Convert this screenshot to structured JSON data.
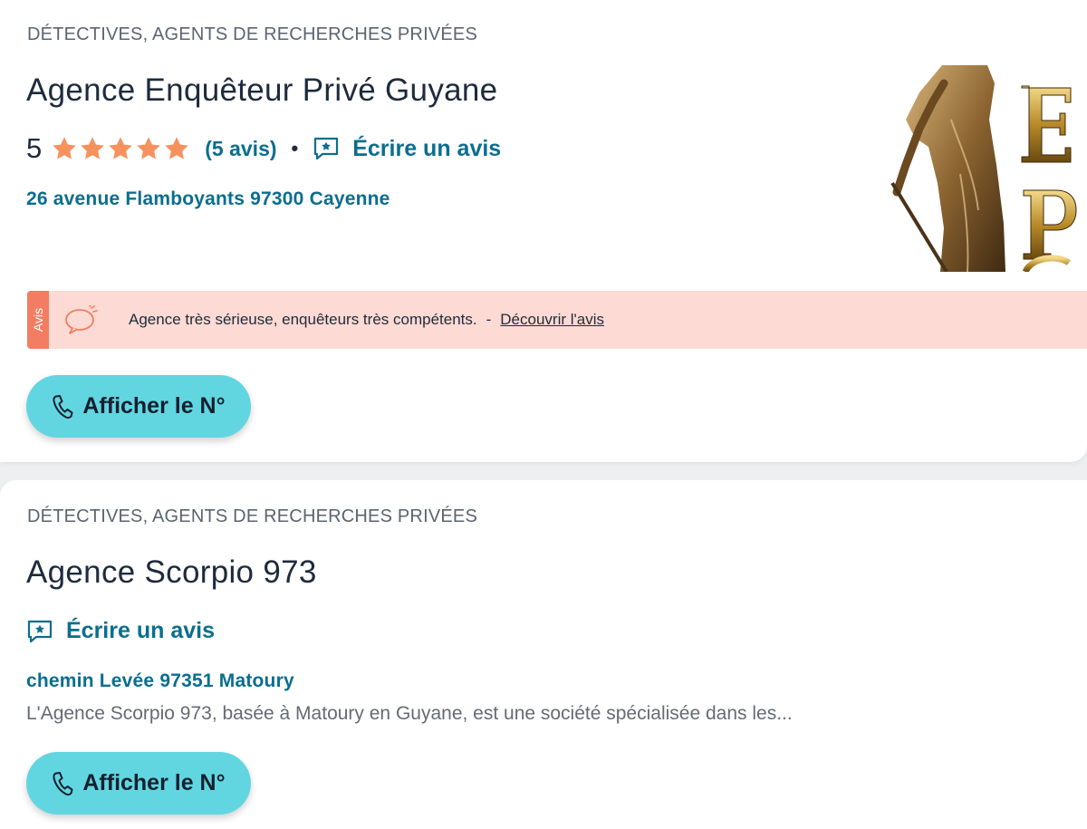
{
  "listings": [
    {
      "category": "DÉTECTIVES, AGENTS DE RECHERCHES PRIVÉES",
      "name": "Agence Enquêteur Privé Guyane",
      "rating": "5",
      "stars": 5,
      "reviews_link": "(5 avis)",
      "separator": "•",
      "write_review": "Écrire un avis",
      "address": "26 avenue Flamboyants 97300 Cayenne",
      "review_banner": {
        "tag": "Avis",
        "text": "Agence très sérieuse, enquêteurs très compétents.",
        "separator": "-",
        "link": "Découvrir l'avis"
      },
      "thumbnail_letters": "ÉPC",
      "phone_button": "Afficher le N°"
    },
    {
      "category": "DÉTECTIVES, AGENTS DE RECHERCHES PRIVÉES",
      "name": "Agence Scorpio 973",
      "write_review": "Écrire un avis",
      "address": "chemin Levée 97351 Matoury",
      "description": "L'Agence Scorpio 973, basée à Matoury en Guyane, est une société spécialisée dans les...",
      "phone_button": "Afficher le N°"
    }
  ],
  "colors": {
    "link": "#0a6e8e",
    "star": "#f5925e",
    "banner_bg": "#fddad3",
    "banner_tag": "#f27d62",
    "button_bg": "#62d6e0"
  },
  "icons": [
    "star-icon",
    "review-star-bubble-icon",
    "speech-bubble-icon",
    "phone-icon"
  ]
}
